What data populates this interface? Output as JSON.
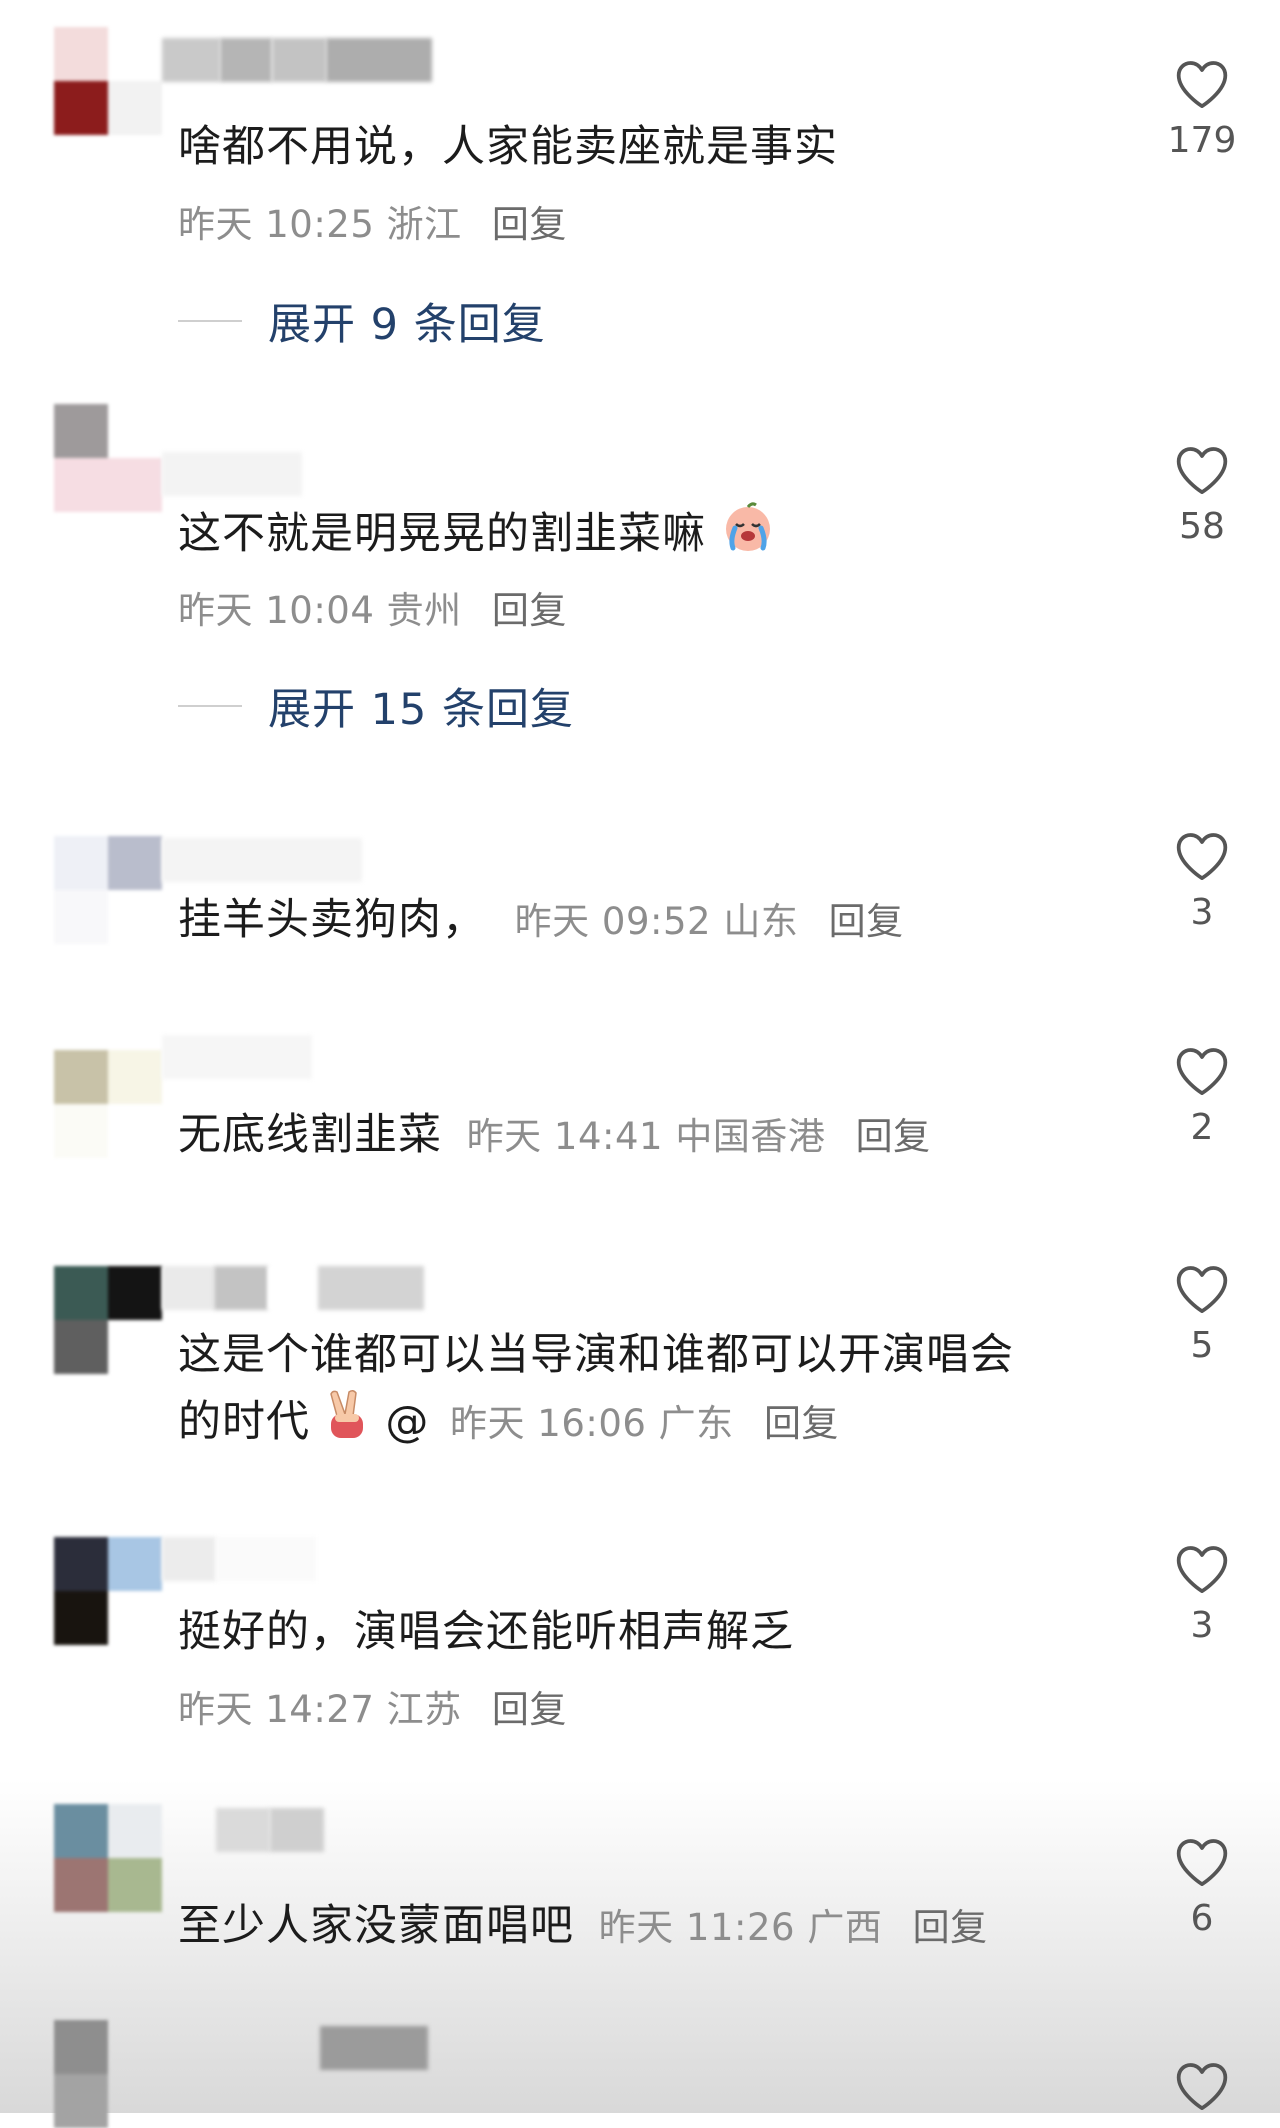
{
  "comments": [
    {
      "text": "啥都不用说，人家能卖座就是事实",
      "time": "昨天 10:25",
      "location": "浙江",
      "reply": "回复",
      "likes": "179",
      "expand": "展开 9 条回复",
      "avatar_colors": [
        "#f3dcdc",
        "#ffffff",
        "#8c1c1c",
        "#f2f2f2"
      ]
    },
    {
      "text": "这不就是明晃晃的割韭菜嘛",
      "emoji": "crying-face-icon",
      "time": "昨天 10:04",
      "location": "贵州",
      "reply": "回复",
      "likes": "58",
      "expand": "展开 15 条回复",
      "avatar_colors": [
        "#9e9a9b",
        "#ffffff",
        "#f6dde3",
        "#f6dde3"
      ]
    },
    {
      "text": "挂羊头卖狗肉，",
      "time": "昨天 09:52",
      "location": "山东",
      "reply": "回复",
      "likes": "3",
      "avatar_colors": [
        "#eef0f6",
        "#b9bdcc",
        "#f8f8fa",
        "#ffffff"
      ]
    },
    {
      "text": "无底线割韭菜",
      "time": "昨天 14:41",
      "location": "中国香港",
      "reply": "回复",
      "likes": "2",
      "avatar_colors": [
        "#c8c2a8",
        "#f7f5e6",
        "#fbfbf6",
        "#ffffff"
      ]
    },
    {
      "text_line1": "这是个谁都可以当导演和谁都可以开演唱会",
      "text_line2": "的时代",
      "emoji": "victory-hand-icon",
      "mention": "@",
      "time": "昨天 16:06",
      "location": "广东",
      "reply": "回复",
      "likes": "5",
      "avatar_colors": [
        "#3b5a54",
        "#141414",
        "#5f5f5f",
        "#ffffff"
      ]
    },
    {
      "text": "挺好的，演唱会还能听相声解乏",
      "time": "昨天 14:27",
      "location": "江苏",
      "reply": "回复",
      "likes": "3",
      "avatar_colors": [
        "#2b2d3a",
        "#a8c6e4",
        "#18140f",
        "#ffffff"
      ]
    },
    {
      "text": "至少人家没蒙面唱吧",
      "time": "昨天 11:26",
      "location": "广西",
      "reply": "回复",
      "likes": "6",
      "avatar_colors": [
        "#6a8ea0",
        "#e9ecef",
        "#9c7572",
        "#a8b890"
      ]
    }
  ],
  "colors": {
    "text": "#1c1c1c",
    "meta": "#8d8d8d",
    "expand": "#23416b",
    "heart": "#555555"
  }
}
